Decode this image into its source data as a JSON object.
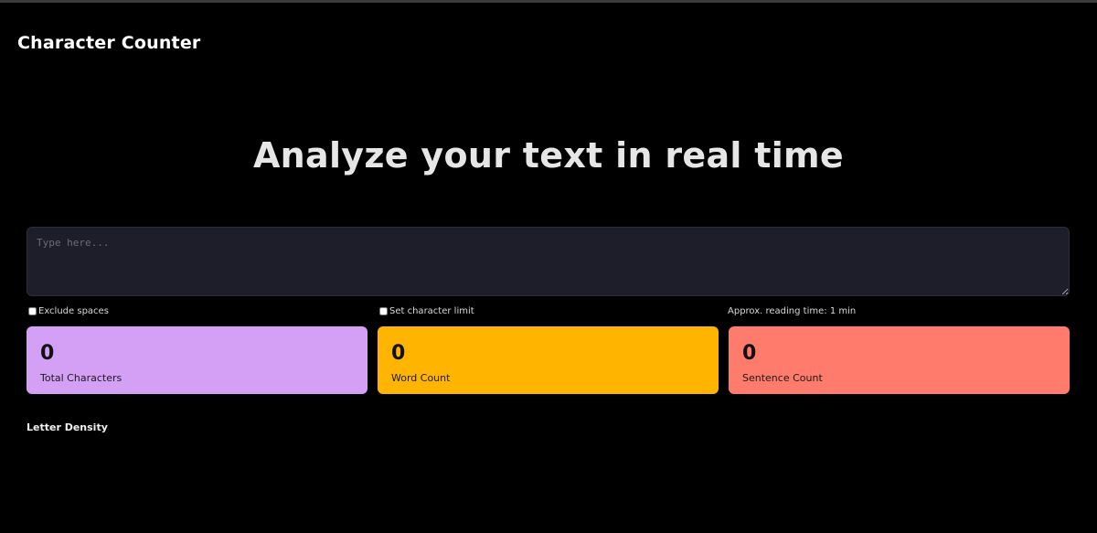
{
  "header": {
    "title": "Character Counter"
  },
  "hero": {
    "heading": "Analyze your text in real time"
  },
  "input": {
    "placeholder": "Type here...",
    "value": ""
  },
  "options": {
    "exclude_spaces": {
      "label": "Exclude spaces",
      "checked": false
    },
    "char_limit": {
      "label": "Set character limit",
      "checked": false
    },
    "reading_time": "Approx. reading time: 1 min"
  },
  "stats": [
    {
      "value": "0",
      "label": "Total Characters",
      "color": "#d3a0f5"
    },
    {
      "value": "0",
      "label": "Word Count",
      "color": "#ffb400"
    },
    {
      "value": "0",
      "label": "Sentence Count",
      "color": "#ff7b6b"
    }
  ],
  "density": {
    "title": "Letter Density"
  }
}
